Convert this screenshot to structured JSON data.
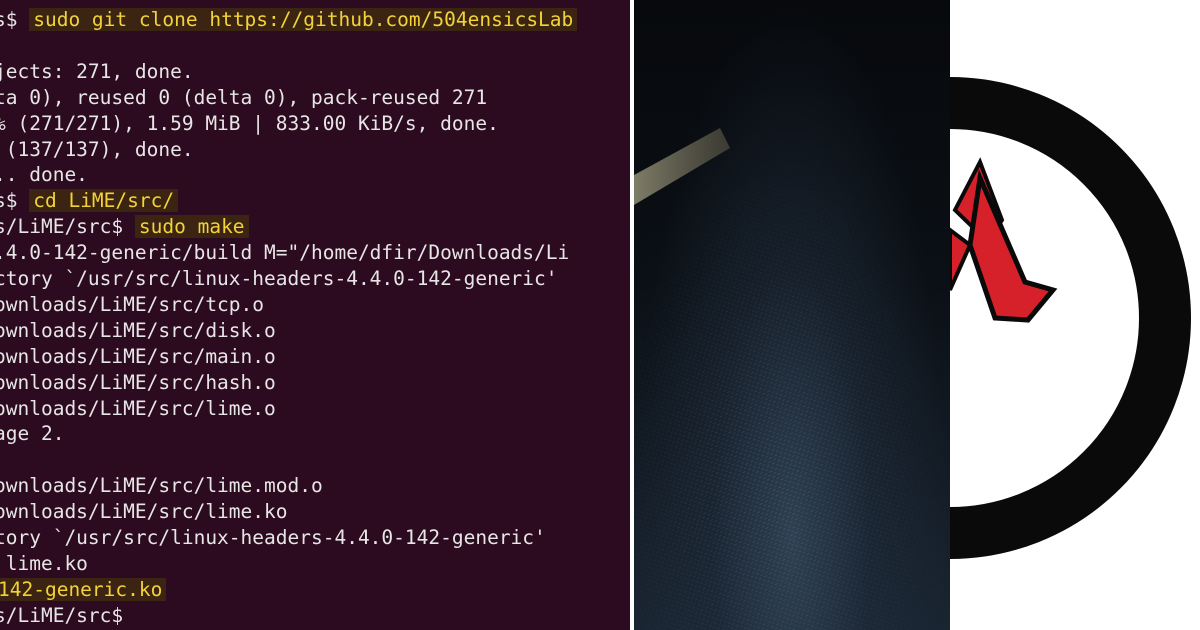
{
  "terminal": {
    "lines": [
      {
        "pre": "s$ ",
        "hl": "sudo git clone https://github.com/504ensicsLab",
        "post": ""
      },
      {
        "pre": "",
        "hl": "",
        "post": ""
      },
      {
        "pre": "jects: 271, done.",
        "hl": "",
        "post": ""
      },
      {
        "pre": "ta 0), reused 0 (delta 0), pack-reused 271",
        "hl": "",
        "post": ""
      },
      {
        "pre": "% (271/271), 1.59 MiB | 833.00 KiB/s, done.",
        "hl": "",
        "post": ""
      },
      {
        "pre": " (137/137), done.",
        "hl": "",
        "post": ""
      },
      {
        "pre": ".. done.",
        "hl": "",
        "post": ""
      },
      {
        "pre": "s$ ",
        "hl": "cd LiME/src/",
        "post": ""
      },
      {
        "pre": "s/LiME/src$ ",
        "hl": "sudo make",
        "post": ""
      },
      {
        "pre": ".4.0-142-generic/build M=\"/home/dfir/Downloads/Li",
        "hl": "",
        "post": ""
      },
      {
        "pre": "ctory `/usr/src/linux-headers-4.4.0-142-generic'",
        "hl": "",
        "post": ""
      },
      {
        "pre": "ownloads/LiME/src/tcp.o",
        "hl": "",
        "post": ""
      },
      {
        "pre": "ownloads/LiME/src/disk.o",
        "hl": "",
        "post": ""
      },
      {
        "pre": "ownloads/LiME/src/main.o",
        "hl": "",
        "post": ""
      },
      {
        "pre": "ownloads/LiME/src/hash.o",
        "hl": "",
        "post": ""
      },
      {
        "pre": "ownloads/LiME/src/lime.o",
        "hl": "",
        "post": ""
      },
      {
        "pre": "age 2.",
        "hl": "",
        "post": ""
      },
      {
        "pre": "",
        "hl": "",
        "post": ""
      },
      {
        "pre": "ownloads/LiME/src/lime.mod.o",
        "hl": "",
        "post": ""
      },
      {
        "pre": "ownloads/LiME/src/lime.ko",
        "hl": "",
        "post": ""
      },
      {
        "pre": "tory `/usr/src/linux-headers-4.4.0-142-generic'",
        "hl": "",
        "post": ""
      },
      {
        "pre": " lime.ko",
        "hl": "",
        "post": ""
      },
      {
        "pre": "",
        "hl": "142-generic.ko",
        "post": ""
      },
      {
        "pre": "s/LiME/src$",
        "hl": "",
        "post": ""
      }
    ]
  },
  "colors": {
    "terminal_bg": "#2c0a1f",
    "highlight_text": "#f3d23a",
    "logo_red": "#d6212b",
    "logo_black": "#0a0a0a"
  },
  "icons": {
    "logo": "red-lambda-logo-icon"
  }
}
